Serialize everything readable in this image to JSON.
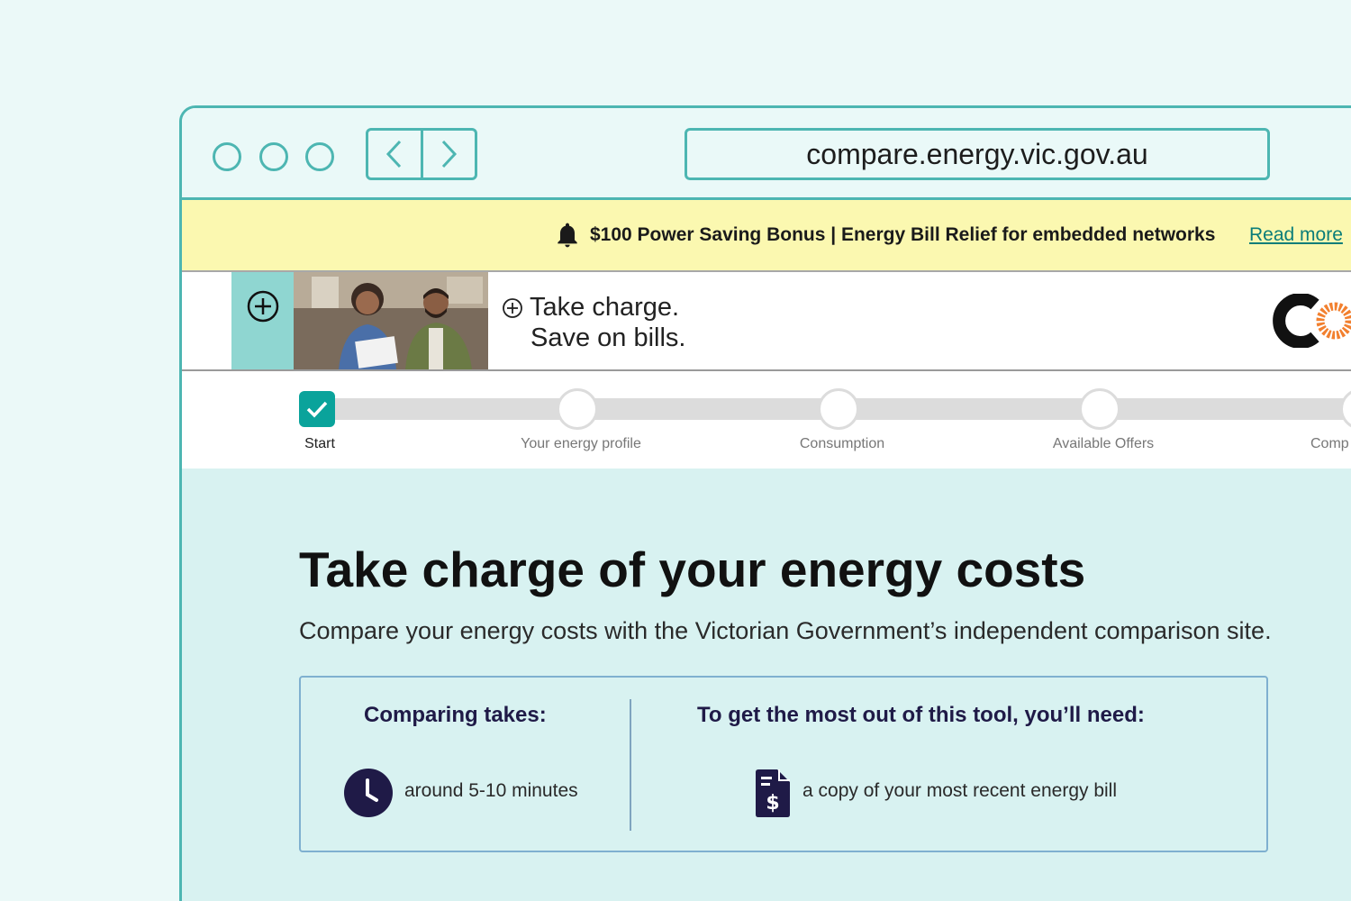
{
  "browser": {
    "url": "compare.energy.vic.gov.au"
  },
  "announcement": {
    "icon": "bell-icon",
    "message": "$100 Power Saving Bonus | Energy Bill Relief for embedded networks",
    "link": "Read more"
  },
  "banner": {
    "line1": "Take charge.",
    "line2": "Save on bills."
  },
  "steps": [
    {
      "label": "Start",
      "state": "complete"
    },
    {
      "label": "Your energy profile",
      "state": "pending"
    },
    {
      "label": "Consumption",
      "state": "pending"
    },
    {
      "label": "Available Offers",
      "state": "pending"
    },
    {
      "label": "Comp",
      "state": "pending"
    }
  ],
  "main": {
    "title": "Take charge of your energy costs",
    "subtitle": "Compare your energy costs with the Victorian Government’s independent comparison site.",
    "time": {
      "heading": "Comparing takes:",
      "text": "around 5-10 minutes",
      "icon": "clock-icon"
    },
    "needs": {
      "heading": "To get the most out of this tool, you’ll need:",
      "text": "a copy of your most recent energy bill",
      "icon": "bill-icon"
    }
  },
  "colors": {
    "accent": "#4db6b2",
    "announcement_bg": "#fbf8b0",
    "complete": "#0aa39b",
    "navy": "#1f1a47"
  }
}
